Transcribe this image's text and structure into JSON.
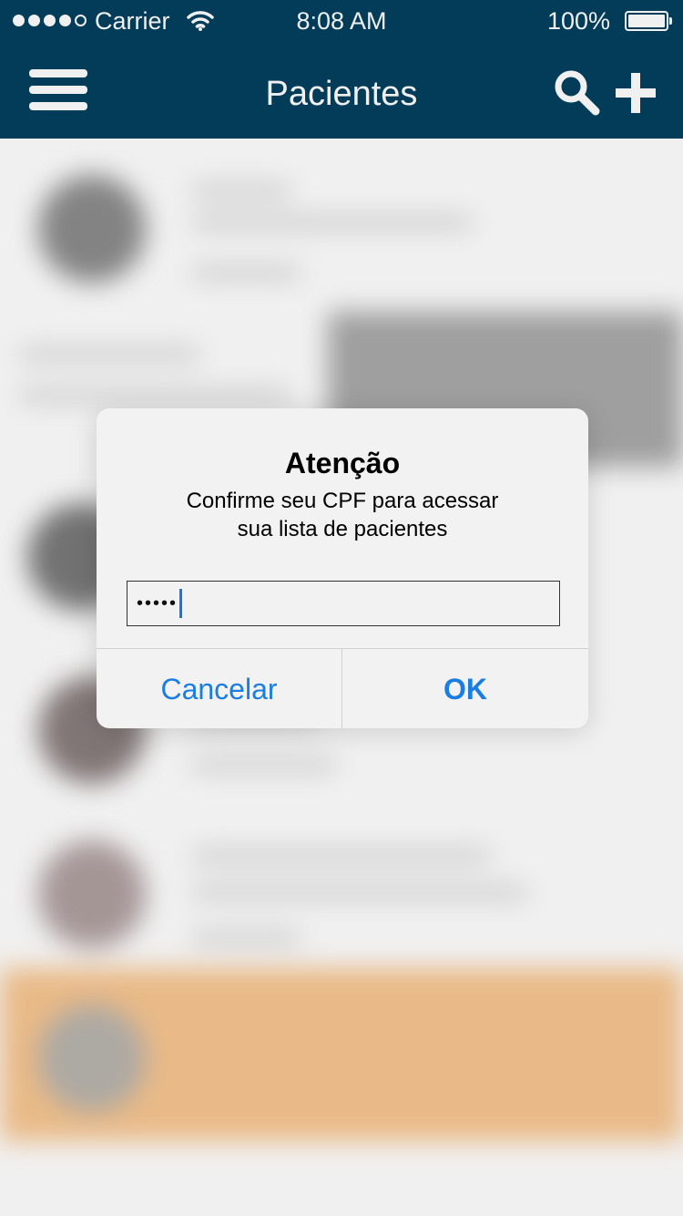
{
  "status_bar": {
    "carrier": "Carrier",
    "time": "8:08 AM",
    "battery_percent": "100%",
    "signal_bars_filled": 4,
    "signal_bars_total": 5
  },
  "nav": {
    "title": "Pacientes",
    "menu_icon": "hamburger-menu-icon",
    "search_icon": "search-icon",
    "add_icon": "plus-icon",
    "background_color": "#03405f"
  },
  "alert": {
    "title": "Atenção",
    "message_line1": "Confirme seu CPF para acessar",
    "message_line2": "sua lista de pacientes",
    "input_value": "•••••",
    "cancel_label": "Cancelar",
    "ok_label": "OK",
    "button_color": "#1a7de2"
  },
  "list": {
    "highlight_color": "#f8c690",
    "placeholder_color": "#a9a9a9"
  }
}
